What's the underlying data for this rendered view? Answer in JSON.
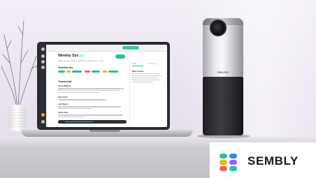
{
  "brand": {
    "name": "SEMBLY"
  },
  "device": {
    "brand": "PHILIPS"
  },
  "screen": {
    "meeting_title": "Weekly Sync",
    "meeting_meta": "Wed, Jun 16 · 11:00 - 11:30 AM · Meeting room · 10",
    "section_title": "Sentiments",
    "transcript_title": "Transcript",
    "panel_tabs": [
      "Notes",
      "Summary"
    ],
    "panel_title": "Main Outline",
    "speakers": [
      "Jason Williams",
      "Kate Carter",
      "Alex Rogers",
      "Sandy Bold"
    ]
  },
  "colors": {
    "accent": "#1fc49b",
    "wall": "#ece6f0"
  }
}
